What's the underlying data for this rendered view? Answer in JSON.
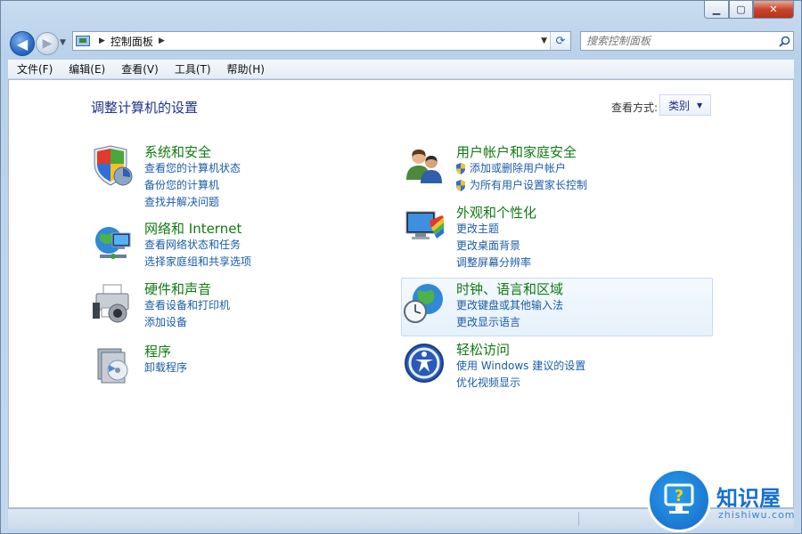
{
  "window": {
    "controls": {
      "minimize": "▁",
      "maximize": "▢",
      "close": "✕"
    }
  },
  "nav": {
    "back_glyph": "◀",
    "forward_glyph": "▶",
    "history_glyph": "▼",
    "address_segment": "控制面板",
    "address_sep": "▶",
    "search_placeholder": "搜索控制面板"
  },
  "menu": [
    {
      "label": "文件(F)"
    },
    {
      "label": "编辑(E)"
    },
    {
      "label": "查看(V)"
    },
    {
      "label": "工具(T)"
    },
    {
      "label": "帮助(H)"
    }
  ],
  "main": {
    "title": "调整计算机的设置",
    "view_label": "查看方式:",
    "view_value": "类别"
  },
  "categories": [
    {
      "title": "系统和安全",
      "icon": "shield-icon",
      "links": [
        "查看您的计算机状态",
        "备份您的计算机",
        "查找并解决问题"
      ]
    },
    {
      "title": "网络和 Internet",
      "icon": "network-icon",
      "links": [
        "查看网络状态和任务",
        "选择家庭组和共享选项"
      ]
    },
    {
      "title": "硬件和声音",
      "icon": "printer-icon",
      "links": [
        "查看设备和打印机",
        "添加设备"
      ]
    },
    {
      "title": "程序",
      "icon": "programs-icon",
      "links": [
        "卸载程序"
      ]
    },
    {
      "title": "用户帐户和家庭安全",
      "icon": "users-icon",
      "links": [
        "添加或删除用户帐户",
        "为所有用户设置家长控制"
      ]
    },
    {
      "title": "外观和个性化",
      "icon": "monitor-icon",
      "links": [
        "更改主题",
        "更改桌面背景",
        "调整屏幕分辨率"
      ]
    },
    {
      "title": "时钟、语言和区域",
      "icon": "globe-clock-icon",
      "links": [
        "更改键盘或其他输入法",
        "更改显示语言"
      ]
    },
    {
      "title": "轻松访问",
      "icon": "accessibility-icon",
      "links": [
        "使用 Windows 建议的设置",
        "优化视频显示"
      ]
    }
  ],
  "watermark": {
    "name": "知识屋",
    "url": "zhishiwu.com"
  }
}
